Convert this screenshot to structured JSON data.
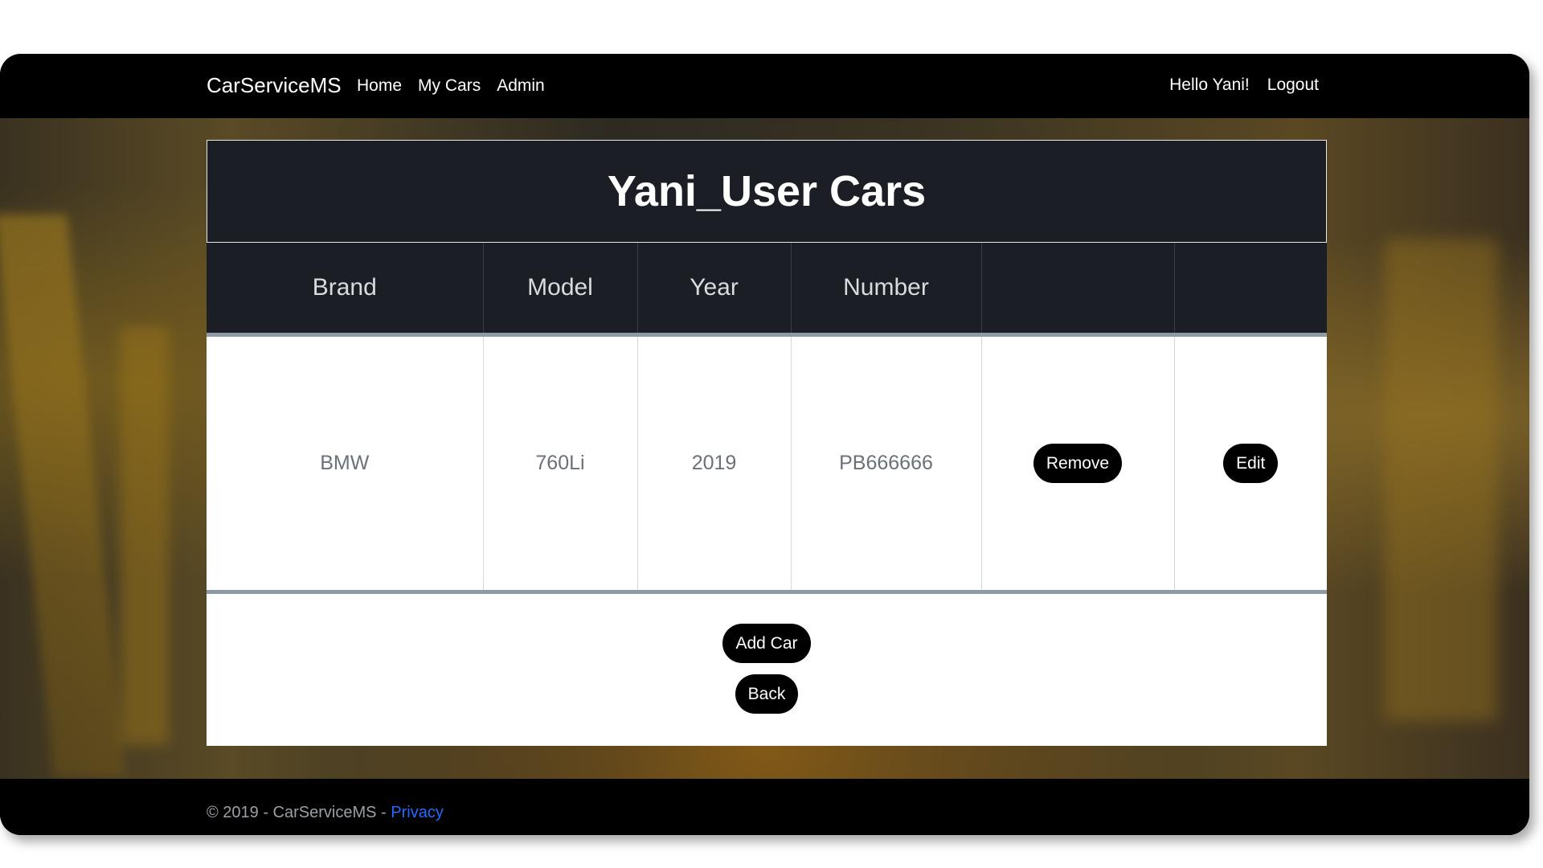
{
  "navbar": {
    "brand": "CarServiceMS",
    "links": [
      "Home",
      "My Cars",
      "Admin"
    ],
    "greeting": "Hello Yani!",
    "logout": "Logout"
  },
  "card": {
    "title": "Yani_User Cars",
    "columns": [
      "Brand",
      "Model",
      "Year",
      "Number",
      "",
      ""
    ],
    "rows": [
      {
        "brand": "BMW",
        "model": "760Li",
        "year": "2019",
        "number": "PB666666",
        "remove_label": "Remove",
        "edit_label": "Edit"
      }
    ],
    "add_car_label": "Add Car",
    "back_label": "Back"
  },
  "footer": {
    "text": "© 2019 - CarServiceMS - ",
    "privacy_label": "Privacy"
  },
  "colors": {
    "accent_link": "#1e6cff",
    "header_dark": "#1b1e24",
    "button_bg": "#000000"
  }
}
